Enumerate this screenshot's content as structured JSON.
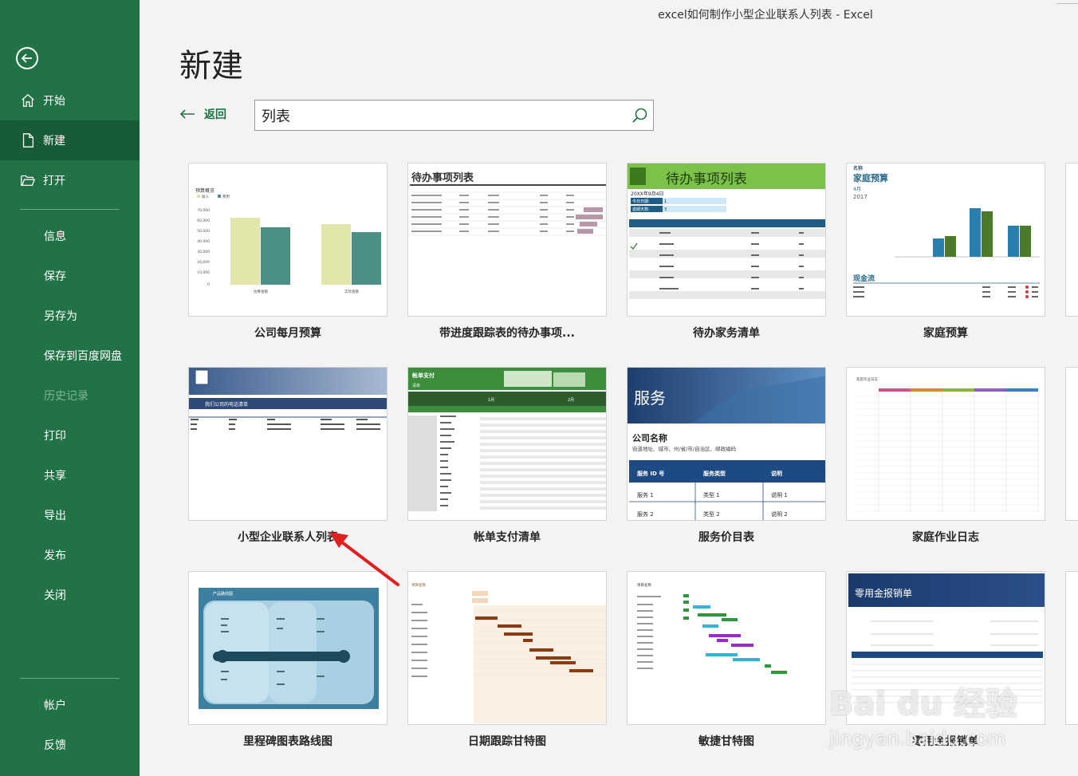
{
  "window": {
    "title": "excel如何制作小型企业联系人列表  -  Excel"
  },
  "sidebar": {
    "back_icon": "back-arrow-circle-icon",
    "items": [
      {
        "label": "开始",
        "icon": "home-icon"
      },
      {
        "label": "新建",
        "icon": "new-document-icon"
      },
      {
        "label": "打开",
        "icon": "open-folder-icon"
      },
      {
        "label": "信息"
      },
      {
        "label": "保存"
      },
      {
        "label": "另存为"
      },
      {
        "label": "保存到百度网盘"
      },
      {
        "label": "历史记录"
      },
      {
        "label": "打印"
      },
      {
        "label": "共享"
      },
      {
        "label": "导出"
      },
      {
        "label": "发布"
      },
      {
        "label": "关闭"
      },
      {
        "label": "帐户"
      },
      {
        "label": "反馈"
      }
    ],
    "accent": "#217346",
    "active_color": "#185c37"
  },
  "main": {
    "title": "新建",
    "back_label": "返回",
    "search": {
      "value": "列表"
    }
  },
  "templates": [
    {
      "label": "公司每月预算",
      "thumb": {
        "title": "预算概览",
        "legend": [
          "收入",
          "费用"
        ],
        "yticks": [
          "70,000",
          "60,000",
          "50,000",
          "40,000",
          "30,000",
          "20,000",
          "10,000",
          "0"
        ],
        "groups": [
          "估算金额",
          "实际金额"
        ]
      }
    },
    {
      "label": "带进度跟踪表的待办事项...",
      "thumb": {
        "title": "待办事项列表"
      }
    },
    {
      "label": "待办家务清单",
      "thumb": {
        "title": "待办事项列表",
        "date": "20XX年9月4日",
        "rows": [
          "今日日期:",
          "逾期天数:"
        ],
        "values": [
          "1",
          "3"
        ]
      }
    },
    {
      "label": "家庭预算",
      "thumb": {
        "name": "名称",
        "title": "家庭预算",
        "month": "4月",
        "year": "2017",
        "cash": "现金流"
      }
    },
    {
      "label": "小型企业联系人列表",
      "thumb": {
        "banner": "我们公司的电话清单"
      }
    },
    {
      "label": "帐单支付清单",
      "thumb": {
        "title": "帐单支付",
        "sub": "清单",
        "m1": "1月",
        "m2": "2月"
      }
    },
    {
      "label": "服务价目表",
      "thumb": {
        "title": "服务",
        "company": "公司名称",
        "address": "街道地址、城市、州/省/市/自治区、邮政编码",
        "cols": [
          "服务 ID 号",
          "服务类型",
          "说明"
        ],
        "r1": [
          "服务 1",
          "类型 1",
          "说明 1"
        ],
        "r2": [
          "服务 2",
          "类型 2",
          "说明 2"
        ]
      }
    },
    {
      "label": "家庭作业日志",
      "thumb": {
        "title": "家庭作业日志"
      }
    },
    {
      "label": "里程碑图表路线图",
      "thumb": {
        "title": "产品路线图"
      }
    },
    {
      "label": "日期跟踪甘特图",
      "thumb": {
        "title": "项目名称"
      }
    },
    {
      "label": "敏捷甘特图",
      "thumb": {
        "title": "项目名称"
      }
    },
    {
      "label": "零用金报销单",
      "thumb": {
        "title": "零用金报销单"
      }
    }
  ],
  "annotation": {
    "arrow_color": "#e02020"
  },
  "watermark": {
    "line1": "Bai du 经验",
    "line2": "jingyan.baidu.com"
  }
}
